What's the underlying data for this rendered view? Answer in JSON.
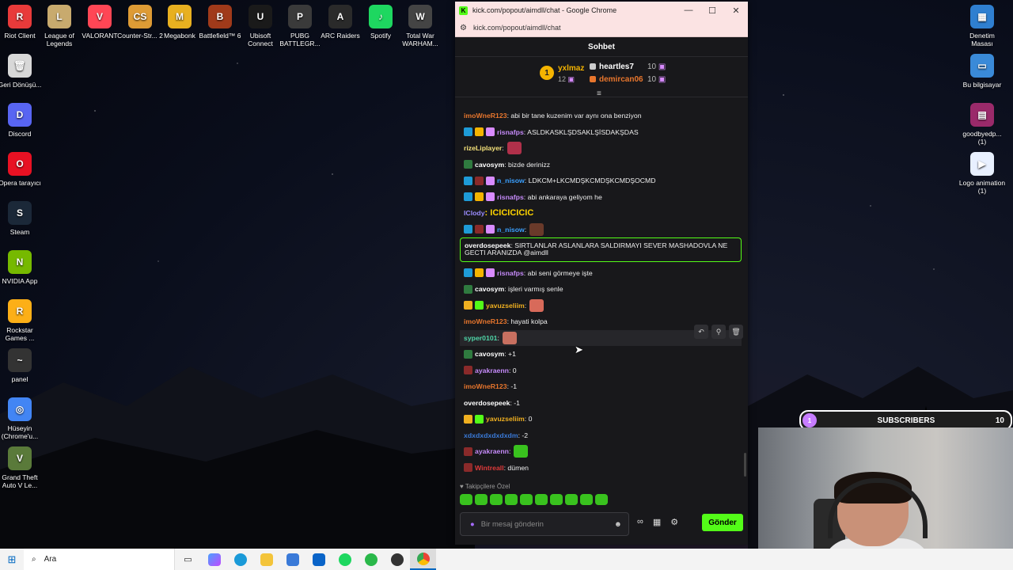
{
  "desktop": {
    "left_icons": [
      {
        "label": "Riot Client",
        "color": "#e83a3a",
        "glyph": "R"
      },
      {
        "label": "Geri Dönüşü...",
        "color": "#d8d8d8",
        "glyph": "🗑"
      },
      {
        "label": "Discord",
        "color": "#5865f2",
        "glyph": "D"
      },
      {
        "label": "Opera tarayıcı",
        "color": "#e81123",
        "glyph": "O"
      },
      {
        "label": "Steam",
        "color": "#1b2838",
        "glyph": "S"
      },
      {
        "label": "NVIDIA App",
        "color": "#76b900",
        "glyph": "N"
      },
      {
        "label": "Rockstar Games ...",
        "color": "#fcaf17",
        "glyph": "R"
      },
      {
        "label": "panel",
        "color": "#333333",
        "glyph": "~"
      },
      {
        "label": "Hüseyin (Chrome'u...",
        "color": "#4285f4",
        "glyph": "◎"
      },
      {
        "label": "Grand Theft Auto V Le...",
        "color": "#5a7a3a",
        "glyph": "V"
      }
    ],
    "top_icons": [
      {
        "label": "League of Legends",
        "color": "#c8aa6e",
        "glyph": "L"
      },
      {
        "label": "VALORANT",
        "color": "#ff4655",
        "glyph": "V"
      },
      {
        "label": "Counter-Str... 2",
        "color": "#de9b35",
        "glyph": "CS"
      },
      {
        "label": "Megabonk",
        "color": "#e8b020",
        "glyph": "M"
      },
      {
        "label": "Battlefield™ 6",
        "color": "#a03a1a",
        "glyph": "B"
      },
      {
        "label": "Ubisoft Connect",
        "color": "#1a1a1a",
        "glyph": "U"
      },
      {
        "label": "PUBG BATTLEGR...",
        "color": "#3a3a3a",
        "glyph": "P"
      },
      {
        "label": "ARC Raiders",
        "color": "#2a2a2a",
        "glyph": "A"
      },
      {
        "label": "Spotify",
        "color": "#1ed760",
        "glyph": "♪"
      },
      {
        "label": "Total War WARHAM...",
        "color": "#444444",
        "glyph": "W"
      }
    ],
    "right_icons": [
      {
        "label": "Denetim Masası",
        "color": "#2f7fd0",
        "glyph": "▦"
      },
      {
        "label": "Bu bilgisayar",
        "color": "#3a8ad8",
        "glyph": "▭"
      },
      {
        "label": "goodbyedp... (1)",
        "color": "#9a2a6a",
        "glyph": "▤"
      },
      {
        "label": "Logo animation (1)",
        "color": "#e8f0ff",
        "glyph": "▶"
      }
    ]
  },
  "browser": {
    "title": "kick.com/popout/aimdll/chat - Google Chrome",
    "url": "kick.com/popout/aimdll/chat",
    "favicon": "K"
  },
  "chat": {
    "header": "Sohbet",
    "leaderboard": {
      "rank": "1",
      "first_user": "yxlmaz",
      "first_count": "12",
      "second_user": "heartles7",
      "second_count": "10",
      "third_user": "demircan06",
      "third_count": "10"
    },
    "messages": [
      {
        "user": "imoWneR123",
        "color": "#e8762d",
        "badges": [],
        "text": ": abi bir tane kuzenim var aynı ona benziyon"
      },
      {
        "user": "risnafps",
        "color": "#c58af9",
        "badges": [
          "#1e9bd7",
          "#f5b400",
          "#d98bff"
        ],
        "text": ": ASLDKASKLŞDSAKLŞİSDAKŞDAS"
      },
      {
        "user": "rizeLiplayer",
        "color": "#f5e27a",
        "badges": [],
        "text": ":",
        "emote": "#b0304a"
      },
      {
        "user": "cavosym",
        "color": "#ffffff",
        "badges": [
          "#2f7a3f"
        ],
        "text": ": bizde derinizz"
      },
      {
        "user": "n_nisow",
        "color": "#3aa0ff",
        "badges": [
          "#1e9bd7",
          "#8a2a2a",
          "#d98bff"
        ],
        "text": ": LDKCM+LKCMDŞKCMDŞKCMDŞOCMD"
      },
      {
        "user": "risnafps",
        "color": "#c58af9",
        "badges": [
          "#1e9bd7",
          "#f5b400",
          "#d98bff"
        ],
        "text": ": abi ankaraya geliyom he"
      },
      {
        "user": "lClody",
        "color": "#9b8cff",
        "badges": [],
        "text": ": ІCICICICIC"
      },
      {
        "user": "n_nisow",
        "color": "#3aa0ff",
        "badges": [
          "#1e9bd7",
          "#8a2a2a",
          "#d98bff"
        ],
        "text": ":",
        "emote": "#6a3a2a"
      },
      {
        "user": "overdosepeek",
        "color": "#ffffff",
        "badges": [],
        "text": ": SIRTLANLAR ASLANLARA SALDIRMAYI SEVER MASHADOVLA NE"
      },
      {
        "user": "",
        "color": "#ffffff",
        "badges": [],
        "text": "GECTI ARANIZDA  @aimdll"
      },
      {
        "user": "risnafps",
        "color": "#c58af9",
        "badges": [
          "#1e9bd7",
          "#f5b400",
          "#d98bff"
        ],
        "text": ": abi seni görmeye işte"
      },
      {
        "user": "cavosym",
        "color": "#ffffff",
        "badges": [
          "#2f7a3f"
        ],
        "text": ": işleri varmış senle"
      },
      {
        "user": "yavuzseliim",
        "color": "#f0b020",
        "badges": [
          "#f0b020",
          "#53fc18"
        ],
        "text": ":",
        "emote": "#d86a5a"
      },
      {
        "user": "imoWneR123",
        "color": "#e8762d",
        "badges": [],
        "text": ": hayati kolpa"
      },
      {
        "user": "syper0101",
        "color": "#4fd6a8",
        "badges": [],
        "text": ":",
        "emote": "#c87060"
      },
      {
        "user": "cavosym",
        "color": "#ffffff",
        "badges": [
          "#2f7a3f"
        ],
        "text": ": +1"
      },
      {
        "user": "ayakraenn",
        "color": "#c58af9",
        "badges": [
          "#8a2a2a"
        ],
        "text": ": 0"
      },
      {
        "user": "imoWneR123",
        "color": "#e8762d",
        "badges": [],
        "text": ": -1"
      },
      {
        "user": "overdosepeek",
        "color": "#ffffff",
        "badges": [],
        "text": ": -1"
      },
      {
        "user": "yavuzseliim",
        "color": "#f0b020",
        "badges": [
          "#f0b020",
          "#53fc18"
        ],
        "text": ": 0"
      },
      {
        "user": "xdxdxdxdxdxdm",
        "color": "#3a7ad8",
        "badges": [],
        "text": ": -2"
      },
      {
        "user": "ayakraenn",
        "color": "#c58af9",
        "badges": [
          "#8a2a2a"
        ],
        "text": ":",
        "emote": "#39c21e"
      },
      {
        "user": "Wintreall",
        "color": "#e03a3a",
        "badges": [
          "#8a2a2a"
        ],
        "text": ": dümen"
      }
    ],
    "followers_only": "♥ Takipçilere Özel",
    "input_placeholder": "Bir mesaj gönderin",
    "send_label": "Gönder"
  },
  "overlay": {
    "subs_circle": "1",
    "subs_label": "SUBSCRIBERS",
    "subs_count": "10"
  },
  "taskbar": {
    "search_label": "Ara"
  }
}
